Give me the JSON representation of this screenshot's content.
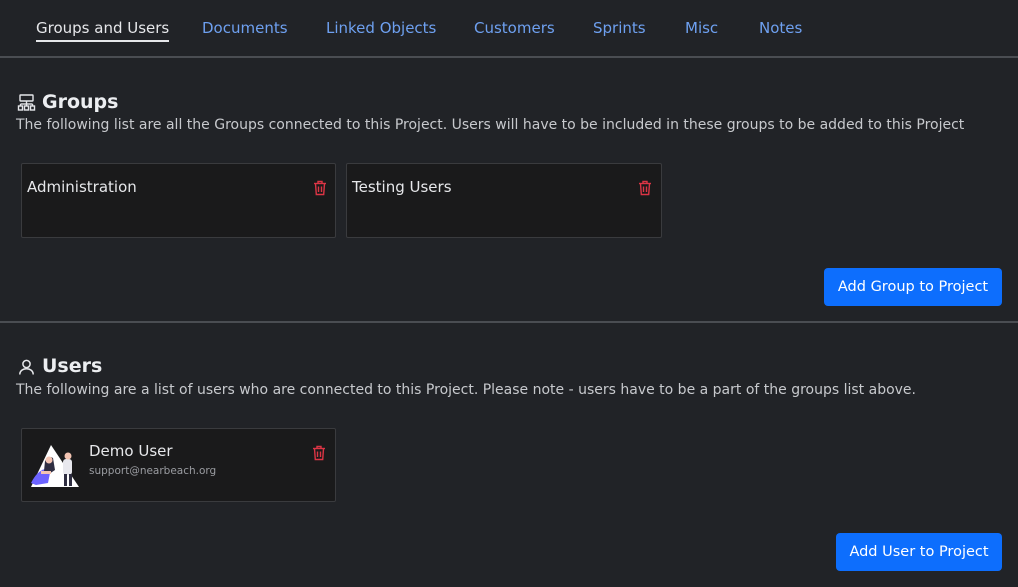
{
  "tabs": [
    {
      "label": "Groups and Users",
      "active": true
    },
    {
      "label": "Documents"
    },
    {
      "label": "Linked Objects"
    },
    {
      "label": "Customers"
    },
    {
      "label": "Sprints"
    },
    {
      "label": "Misc"
    },
    {
      "label": "Notes"
    }
  ],
  "groups": {
    "title": "Groups",
    "icon": "group-hierarchy-icon",
    "description": "The following list are all the Groups connected to this Project. Users will have to be included in these groups to be added to this Project",
    "items": [
      {
        "name": "Administration"
      },
      {
        "name": "Testing Users"
      }
    ],
    "add_button": "Add Group to Project"
  },
  "users": {
    "title": "Users",
    "icon": "user-icon",
    "description": "The following are a list of users who are connected to this Project. Please note - users have to be a part of the groups list above.",
    "items": [
      {
        "name": "Demo User",
        "email": "support@nearbeach.org"
      }
    ],
    "add_button": "Add User to Project"
  },
  "colors": {
    "background": "#212327",
    "card": "#1a1a1b",
    "accent": "#0d6efd",
    "link": "#6ea0f0",
    "danger": "#dc3545"
  }
}
